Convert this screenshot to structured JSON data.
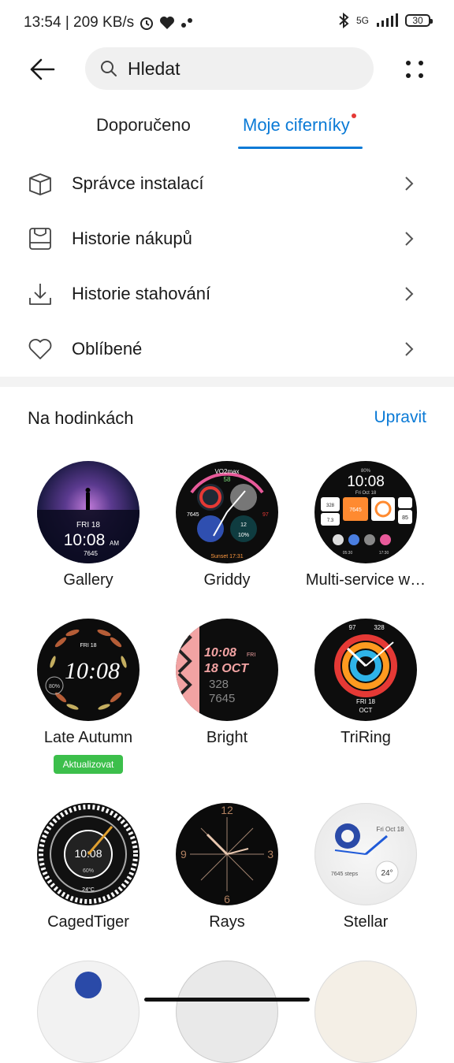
{
  "status": {
    "time_speed": "13:54 | 209 KB/s",
    "network": "5G",
    "battery": "30"
  },
  "search": {
    "placeholder": "Hledat"
  },
  "tabs": [
    {
      "label": "Doporučeno"
    },
    {
      "label": "Moje ciferníky"
    }
  ],
  "menu": [
    {
      "label": "Správce instalací",
      "icon": "box-icon"
    },
    {
      "label": "Historie nákupů",
      "icon": "purchase-icon"
    },
    {
      "label": "Historie stahování",
      "icon": "download-icon"
    },
    {
      "label": "Oblíbené",
      "icon": "heart-icon"
    }
  ],
  "section": {
    "title": "Na hodinkách",
    "edit": "Upravit"
  },
  "faces": [
    {
      "name": "Gallery",
      "dial_text": {
        "date": "FRI 18",
        "time": "10:08",
        "ampm": "AM",
        "steps": "7645"
      }
    },
    {
      "name": "Griddy",
      "dial_text": {
        "top": "VO2max",
        "val": "58",
        "left": "7645",
        "right": "97",
        "bottom": "Sunset 17:31",
        "mid1": "12",
        "mid2": "10%"
      }
    },
    {
      "name": "Multi-service w…",
      "dial_text": {
        "battery": "80%",
        "time": "10:08",
        "date": "Fri Oct 18",
        "kcal": "328",
        "steps": "7645",
        "dist": "7.3",
        "bpm": "85",
        "sunrise": "05:30",
        "sunset": "17:30"
      }
    },
    {
      "name": "Late Autumn",
      "badge": "Aktualizovat",
      "dial_text": {
        "date": "FRI 18",
        "time": "10:08",
        "pct": "80%"
      }
    },
    {
      "name": "Bright",
      "dial_text": {
        "time": "10:08",
        "day": "FRI",
        "date": "18 OCT",
        "v1": "328",
        "v2": "7645"
      }
    },
    {
      "name": "TriRing",
      "dial_text": {
        "top1": "97",
        "top2": "328",
        "date": "FRI 18",
        "month": "OCT"
      }
    },
    {
      "name": "CagedTiger",
      "dial_text": {
        "time": "10:08",
        "sub": "60%",
        "temp": "24°C"
      }
    },
    {
      "name": "Rays",
      "dial_text": {
        "n12": "12",
        "n3": "3",
        "n6": "6",
        "n9": "9"
      }
    },
    {
      "name": "Stellar",
      "dial_text": {
        "date": "Fri Oct 18",
        "steps": "7645 steps",
        "temp": "24°"
      }
    }
  ],
  "colors": {
    "accent": "#0a7ad6",
    "badge": "#3cbf4b",
    "dot": "#e53935"
  }
}
